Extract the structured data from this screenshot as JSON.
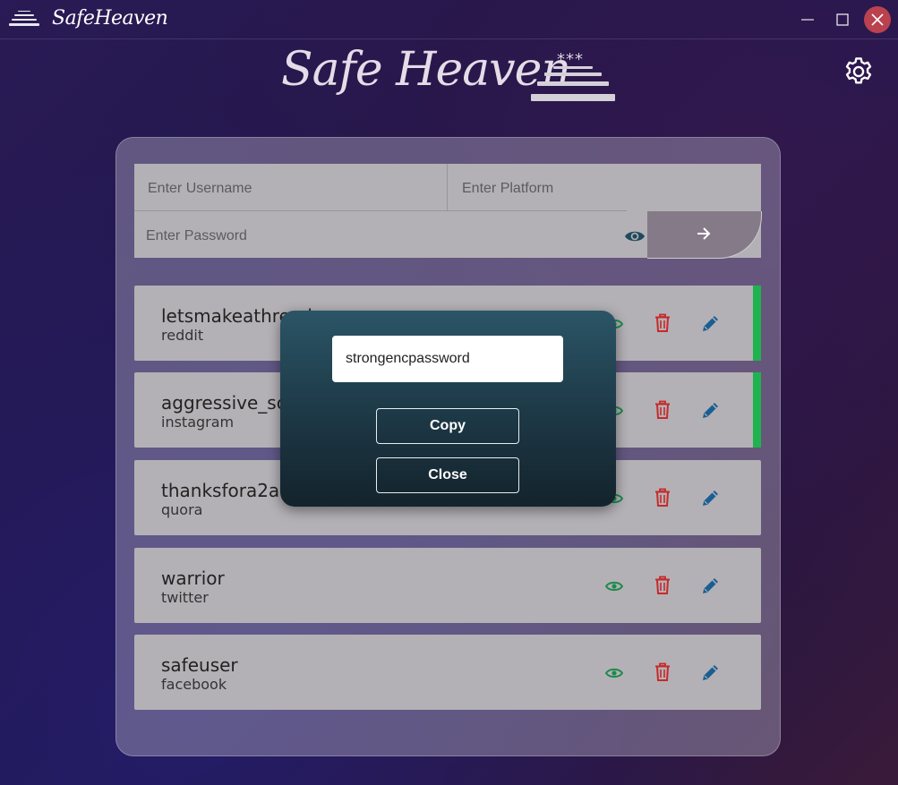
{
  "window": {
    "title": "SafeHeaven",
    "minimize_icon": "minimize-icon",
    "maximize_icon": "maximize-icon",
    "close_icon": "close-icon"
  },
  "header": {
    "title": "Safe Heaven",
    "logo_stars": "***",
    "settings_icon": "gear-icon"
  },
  "form": {
    "username_placeholder": "Enter Username",
    "platform_placeholder": "Enter Platform",
    "password_placeholder": "Enter Password",
    "show_password_icon": "eye-icon",
    "submit_icon": "arrow-right-icon"
  },
  "entries": [
    {
      "username": "letsmakeathread",
      "platform": "reddit",
      "active": true
    },
    {
      "username": "aggressive_scroller",
      "platform": "instagram",
      "active": true
    },
    {
      "username": "thanksfora2a",
      "platform": "quora",
      "active": false
    },
    {
      "username": "warrior",
      "platform": "twitter",
      "active": false
    },
    {
      "username": "safeuser",
      "platform": "facebook",
      "active": false
    }
  ],
  "modal": {
    "password_value": "strongencpassword",
    "copy_label": "Copy",
    "close_label": "Close"
  },
  "colors": {
    "eye": "#1e8a4c",
    "delete": "#c62a2a",
    "edit": "#1a5f92",
    "active_indicator": "#1fb34f",
    "window_close": "#b9424e"
  }
}
